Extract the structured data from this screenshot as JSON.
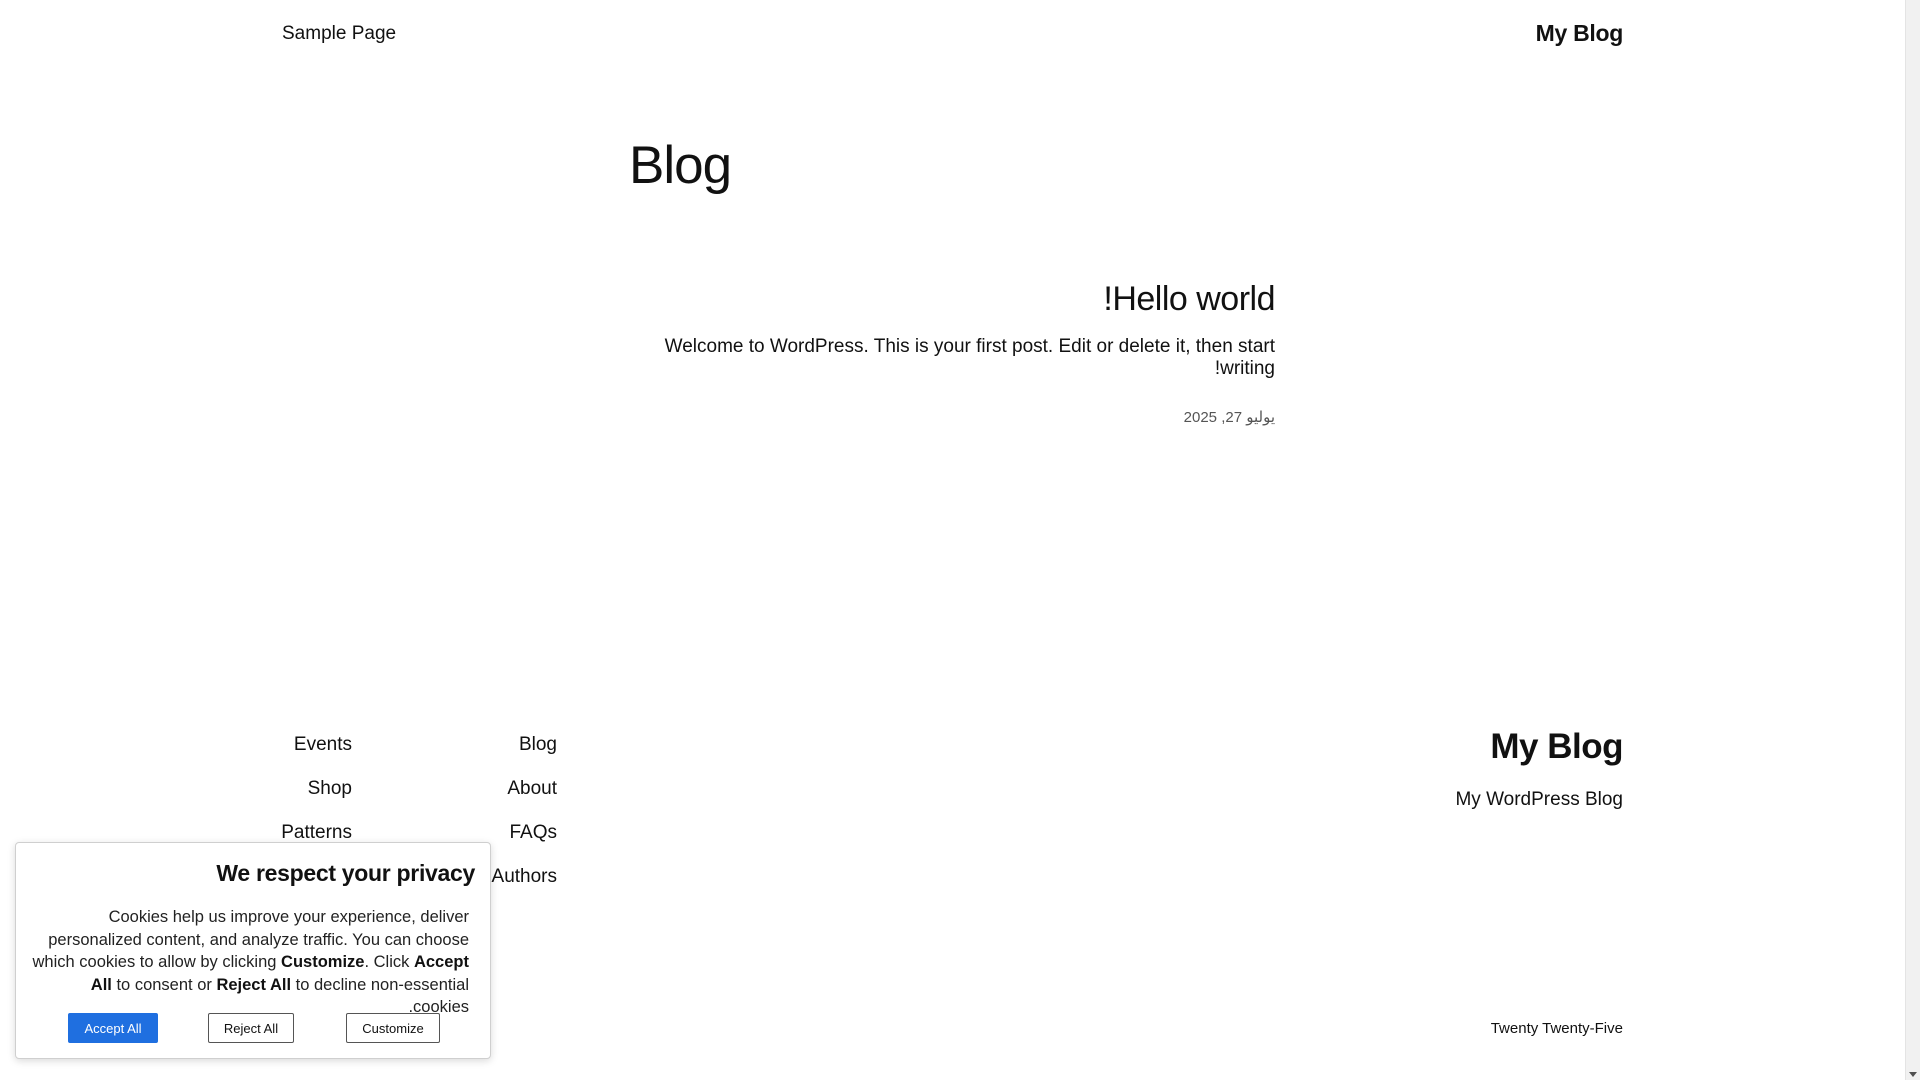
{
  "header": {
    "site_title": "My Blog",
    "nav": [
      "Sample Page"
    ]
  },
  "main": {
    "heading": "Blog",
    "posts": [
      {
        "title": "Hello world!",
        "excerpt": "Welcome to WordPress. This is your first post. Edit or delete it, then start writing!",
        "date": "يوليو 27, 2025"
      }
    ]
  },
  "footer": {
    "site_title": "My Blog",
    "tagline": "My WordPress Blog",
    "nav_col_1": [
      "Blog",
      "About",
      "FAQs",
      "Authors"
    ],
    "nav_col_2": [
      "Events",
      "Shop",
      "Patterns"
    ],
    "credit": "Twenty Twenty-Five"
  },
  "cookie_banner": {
    "title": "We respect your privacy",
    "text_part_1": "Cookies help us improve your experience, deliver personalized content, and analyze traffic. You can choose which cookies to allow by clicking ",
    "text_customize": "Customize",
    "text_part_2": ". Click ",
    "text_accept": "Accept All",
    "text_part_3": " to consent or ",
    "text_reject": "Reject All",
    "text_part_4": " to decline non-essential cookies.",
    "buttons": {
      "accept": "Accept All",
      "reject": "Reject All",
      "customize": "Customize"
    },
    "accent_color": "#1f6fe0"
  }
}
